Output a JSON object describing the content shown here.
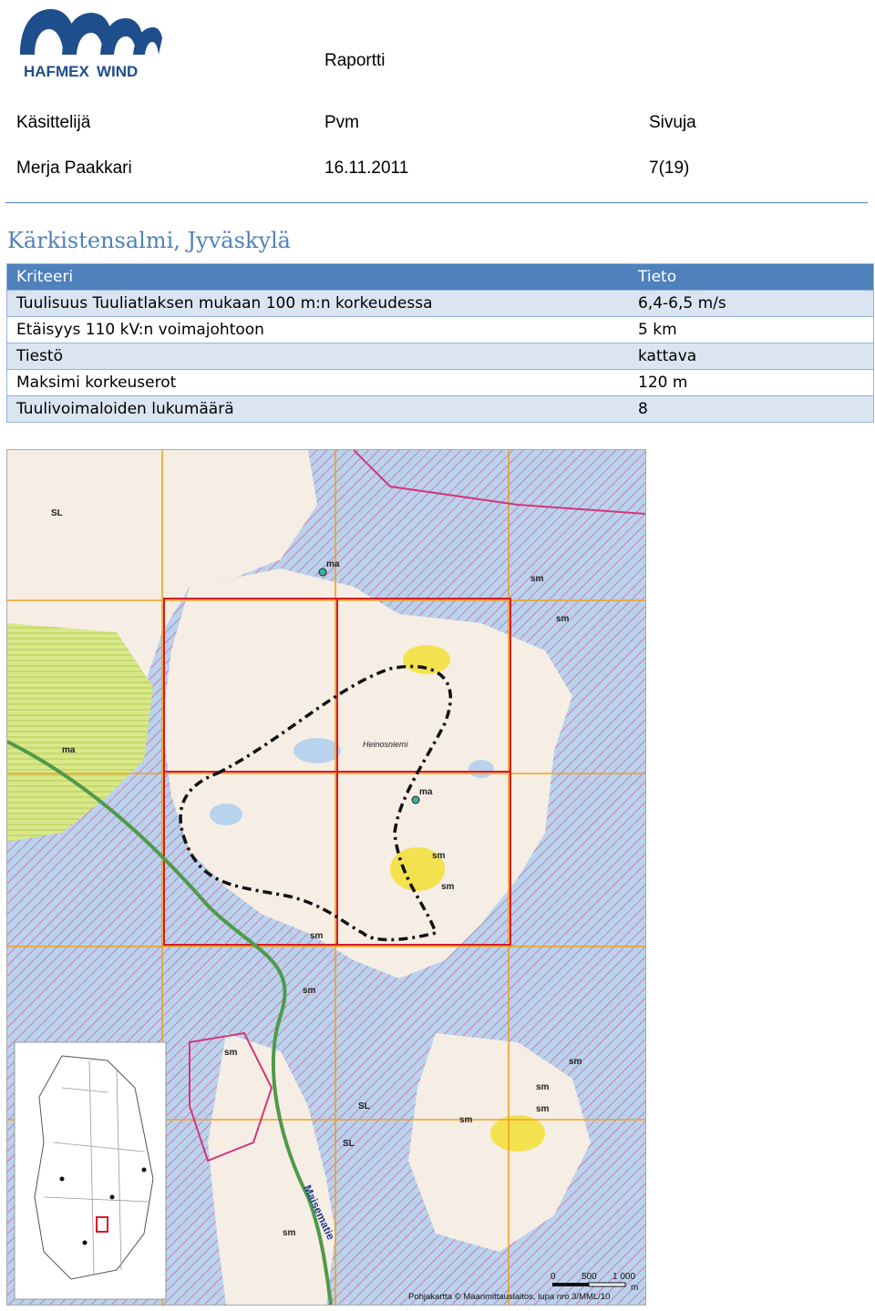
{
  "logo": {
    "text": "HAFMEXWIND",
    "text_part1": "HAFMEX",
    "text_part2": "WIND"
  },
  "header": {
    "doc_type": "Raportti",
    "col1_label": "Käsittelijä",
    "col2_label": "Pvm",
    "col3_label": "Sivuja",
    "col1_value": "Merja Paakkari",
    "col2_value": "16.11.2011",
    "col3_value": "7(19)"
  },
  "site_title": "Kärkistensalmi, Jyväskylä",
  "table": {
    "header": {
      "label": "Kriteeri",
      "value": "Tieto"
    },
    "rows": [
      {
        "label": "Tuulisuus Tuuliatlaksen mukaan 100 m:n korkeudessa",
        "value": "6,4-6,5 m/s"
      },
      {
        "label": "Etäisyys 110 kV:n voimajohtoon",
        "value": "5 km"
      },
      {
        "label": "Tiestö",
        "value": "kattava"
      },
      {
        "label": "Maksimi korkeuserot",
        "value": "120 m"
      },
      {
        "label": "Tuulivoimaloiden lukumäärä",
        "value": "8"
      }
    ]
  },
  "map": {
    "place_labels": [
      "Heinosniemi",
      "Maisematie",
      "SL",
      "SL",
      "SL",
      "ma",
      "ma",
      "ma",
      "sm",
      "sm",
      "sm",
      "sm",
      "sm",
      "sm",
      "sm",
      "sm",
      "sm",
      "sm",
      "sm",
      "sm"
    ],
    "scale": {
      "ticks": [
        "0",
        "500",
        "1 000"
      ],
      "unit": "m"
    },
    "credit": "Pohjakartta © Maanmittauslaitos, lupa nro 3/MML/10"
  }
}
